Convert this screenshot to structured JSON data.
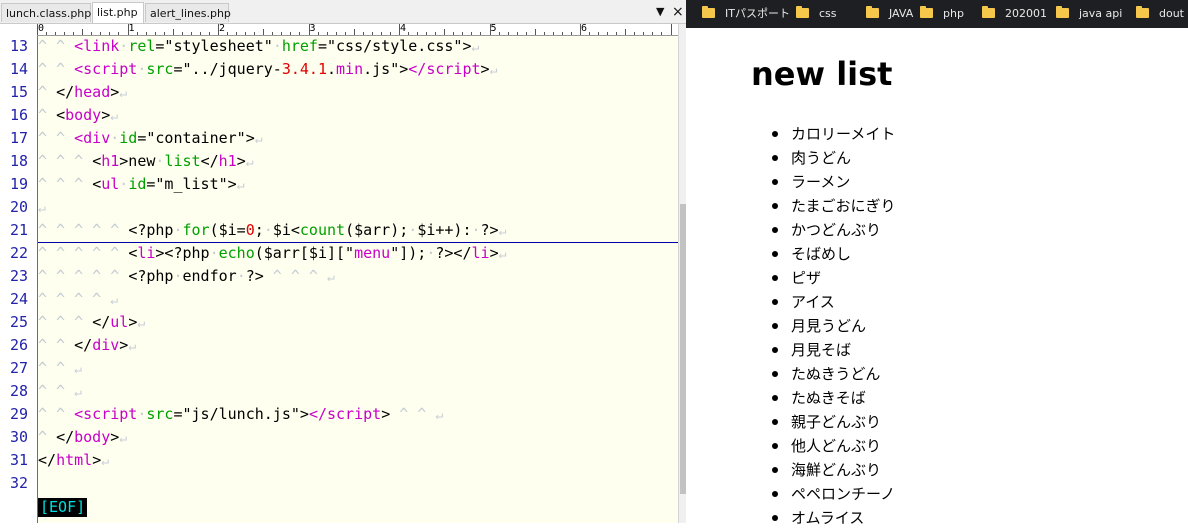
{
  "editor": {
    "tabs": [
      {
        "label": "lunch.class.php",
        "active": false
      },
      {
        "label": "list.php",
        "active": true
      },
      {
        "label": "alert_lines.php",
        "active": false
      }
    ],
    "tab_controls": {
      "dropdown": "▼",
      "close": "×"
    },
    "ruler_marks": [
      "0",
      "1",
      "2",
      "3",
      "4",
      "5",
      "6"
    ],
    "line_numbers": [
      "13",
      "14",
      "15",
      "16",
      "17",
      "18",
      "19",
      "20",
      "21",
      "22",
      "23",
      "24",
      "25",
      "26",
      "27",
      "28",
      "29",
      "30",
      "31",
      "32"
    ],
    "eof_marker": "[EOF]",
    "lines": [
      [
        {
          "c": "ind",
          "t": "^ ^ "
        },
        {
          "c": "tag",
          "t": "<link"
        },
        {
          "c": "dot",
          "t": "·"
        },
        {
          "c": "attr",
          "t": "rel"
        },
        {
          "c": "plain",
          "t": "=\"stylesheet\""
        },
        {
          "c": "dot",
          "t": "·"
        },
        {
          "c": "attr",
          "t": "href"
        },
        {
          "c": "plain",
          "t": "=\"css/style.css\">"
        },
        {
          "c": "eol",
          "t": "↵"
        }
      ],
      [
        {
          "c": "ind",
          "t": "^ ^ "
        },
        {
          "c": "tag",
          "t": "<script"
        },
        {
          "c": "dot",
          "t": "·"
        },
        {
          "c": "attr",
          "t": "src"
        },
        {
          "c": "plain",
          "t": "=\"../jquery-"
        },
        {
          "c": "num",
          "t": "3.4.1"
        },
        {
          "c": "plain",
          "t": "."
        },
        {
          "c": "tag",
          "t": "min"
        },
        {
          "c": "plain",
          "t": ".js\">"
        },
        {
          "c": "tag",
          "t": "</script"
        },
        {
          "c": "plain",
          "t": ">"
        },
        {
          "c": "eol",
          "t": "↵"
        }
      ],
      [
        {
          "c": "ind",
          "t": "^ "
        },
        {
          "c": "plain",
          "t": "</"
        },
        {
          "c": "tag",
          "t": "head"
        },
        {
          "c": "plain",
          "t": ">"
        },
        {
          "c": "eol",
          "t": "↵"
        }
      ],
      [
        {
          "c": "ind",
          "t": "^ "
        },
        {
          "c": "plain",
          "t": "<"
        },
        {
          "c": "tag",
          "t": "body"
        },
        {
          "c": "plain",
          "t": ">"
        },
        {
          "c": "eol",
          "t": "↵"
        }
      ],
      [
        {
          "c": "ind",
          "t": "^ ^ "
        },
        {
          "c": "tag",
          "t": "<div"
        },
        {
          "c": "dot",
          "t": "·"
        },
        {
          "c": "attr",
          "t": "id"
        },
        {
          "c": "plain",
          "t": "=\"container\">"
        },
        {
          "c": "eol",
          "t": "↵"
        }
      ],
      [
        {
          "c": "ind",
          "t": "^ ^ ^ "
        },
        {
          "c": "plain",
          "t": "<"
        },
        {
          "c": "tag",
          "t": "h1"
        },
        {
          "c": "plain",
          "t": ">new"
        },
        {
          "c": "dot",
          "t": "·"
        },
        {
          "c": "kw",
          "t": "list"
        },
        {
          "c": "plain",
          "t": "</"
        },
        {
          "c": "tag",
          "t": "h1"
        },
        {
          "c": "plain",
          "t": ">"
        },
        {
          "c": "eol",
          "t": "↵"
        }
      ],
      [
        {
          "c": "ind",
          "t": "^ ^ ^ "
        },
        {
          "c": "plain",
          "t": "<"
        },
        {
          "c": "tag",
          "t": "ul"
        },
        {
          "c": "dot",
          "t": "·"
        },
        {
          "c": "attr",
          "t": "id"
        },
        {
          "c": "plain",
          "t": "=\"m_list\">"
        },
        {
          "c": "eol",
          "t": "↵"
        }
      ],
      [
        {
          "c": "eol",
          "t": "↵"
        }
      ],
      [
        {
          "c": "ind",
          "t": "^ ^ ^ ^ ^ "
        },
        {
          "c": "plain",
          "t": "<?php"
        },
        {
          "c": "dot",
          "t": "·"
        },
        {
          "c": "kw",
          "t": "for"
        },
        {
          "c": "plain",
          "t": "($i="
        },
        {
          "c": "num",
          "t": "0"
        },
        {
          "c": "plain",
          "t": ";"
        },
        {
          "c": "dot",
          "t": "·"
        },
        {
          "c": "plain",
          "t": "$i<"
        },
        {
          "c": "kw",
          "t": "count"
        },
        {
          "c": "plain",
          "t": "($arr);"
        },
        {
          "c": "dot",
          "t": "·"
        },
        {
          "c": "plain",
          "t": "$i++):"
        },
        {
          "c": "dot",
          "t": "·"
        },
        {
          "c": "plain",
          "t": "?>"
        },
        {
          "c": "eol",
          "t": "↵"
        }
      ],
      [
        {
          "c": "ind",
          "t": "^ ^ ^ ^ ^ "
        },
        {
          "c": "plain",
          "t": "<"
        },
        {
          "c": "tag",
          "t": "li"
        },
        {
          "c": "plain",
          "t": "><?php"
        },
        {
          "c": "dot",
          "t": "·"
        },
        {
          "c": "kw",
          "t": "echo"
        },
        {
          "c": "plain",
          "t": "($arr[$i][\""
        },
        {
          "c": "tag",
          "t": "menu"
        },
        {
          "c": "plain",
          "t": "\"]);"
        },
        {
          "c": "dot",
          "t": "·"
        },
        {
          "c": "plain",
          "t": "?></"
        },
        {
          "c": "tag",
          "t": "li"
        },
        {
          "c": "plain",
          "t": ">"
        },
        {
          "c": "eol",
          "t": "↵"
        }
      ],
      [
        {
          "c": "ind",
          "t": "^ ^ ^ ^ ^ "
        },
        {
          "c": "plain",
          "t": "<?php"
        },
        {
          "c": "dot",
          "t": "·"
        },
        {
          "c": "plain",
          "t": "endfor"
        },
        {
          "c": "dot",
          "t": "·"
        },
        {
          "c": "plain",
          "t": "?>"
        },
        {
          "c": "ind",
          "t": " ^ ^ ^ "
        },
        {
          "c": "eol",
          "t": "↵"
        }
      ],
      [
        {
          "c": "ind",
          "t": "^ ^ ^ ^ "
        },
        {
          "c": "eol",
          "t": "↵"
        }
      ],
      [
        {
          "c": "ind",
          "t": "^ ^ ^ "
        },
        {
          "c": "plain",
          "t": "</"
        },
        {
          "c": "tag",
          "t": "ul"
        },
        {
          "c": "plain",
          "t": ">"
        },
        {
          "c": "eol",
          "t": "↵"
        }
      ],
      [
        {
          "c": "ind",
          "t": "^ ^ "
        },
        {
          "c": "plain",
          "t": "</"
        },
        {
          "c": "tag",
          "t": "div"
        },
        {
          "c": "plain",
          "t": ">"
        },
        {
          "c": "eol",
          "t": "↵"
        }
      ],
      [
        {
          "c": "ind",
          "t": "^ ^ "
        },
        {
          "c": "eol",
          "t": "↵"
        }
      ],
      [
        {
          "c": "ind",
          "t": "^ ^ "
        },
        {
          "c": "eol",
          "t": "↵"
        }
      ],
      [
        {
          "c": "ind",
          "t": "^ ^ "
        },
        {
          "c": "tag",
          "t": "<script"
        },
        {
          "c": "dot",
          "t": "·"
        },
        {
          "c": "attr",
          "t": "src"
        },
        {
          "c": "plain",
          "t": "=\"js/lunch.js\">"
        },
        {
          "c": "tag",
          "t": "</script"
        },
        {
          "c": "plain",
          "t": ">"
        },
        {
          "c": "ind",
          "t": " ^ ^ "
        },
        {
          "c": "eol",
          "t": "↵"
        }
      ],
      [
        {
          "c": "ind",
          "t": "^ "
        },
        {
          "c": "plain",
          "t": "</"
        },
        {
          "c": "tag",
          "t": "body"
        },
        {
          "c": "plain",
          "t": ">"
        },
        {
          "c": "eol",
          "t": "↵"
        }
      ],
      [
        {
          "c": "plain",
          "t": "</"
        },
        {
          "c": "tag",
          "t": "html"
        },
        {
          "c": "plain",
          "t": ">"
        },
        {
          "c": "eol",
          "t": "↵"
        }
      ],
      []
    ]
  },
  "bookmarks": [
    {
      "label": "ITパスポート",
      "icon": "folder-icon"
    },
    {
      "label": "css",
      "icon": "folder-icon"
    },
    {
      "label": "JAVA",
      "icon": "folder-icon"
    },
    {
      "label": "php",
      "icon": "folder-icon"
    },
    {
      "label": "202001",
      "icon": "folder-icon"
    },
    {
      "label": "java api",
      "icon": "folder-icon"
    },
    {
      "label": "dout",
      "icon": "folder-icon"
    }
  ],
  "page": {
    "title": "new list",
    "menu": [
      "カロリーメイト",
      "肉うどん",
      "ラーメン",
      "たまごおにぎり",
      "かつどんぶり",
      "そばめし",
      "ピザ",
      "アイス",
      "月見うどん",
      "月見そば",
      "たぬきうどん",
      "たぬきそば",
      "親子どんぶり",
      "他人どんぶり",
      "海鮮どんぶり",
      "ペペロンチーノ",
      "オムライス"
    ]
  },
  "colors": {
    "tag": "#c800c8",
    "attr": "#00a000",
    "number": "#e00000",
    "line_number": "#2222aa",
    "code_bg": "#fffff0",
    "bookmark_bar": "#1e1f22",
    "folder": "#f5c84c"
  }
}
